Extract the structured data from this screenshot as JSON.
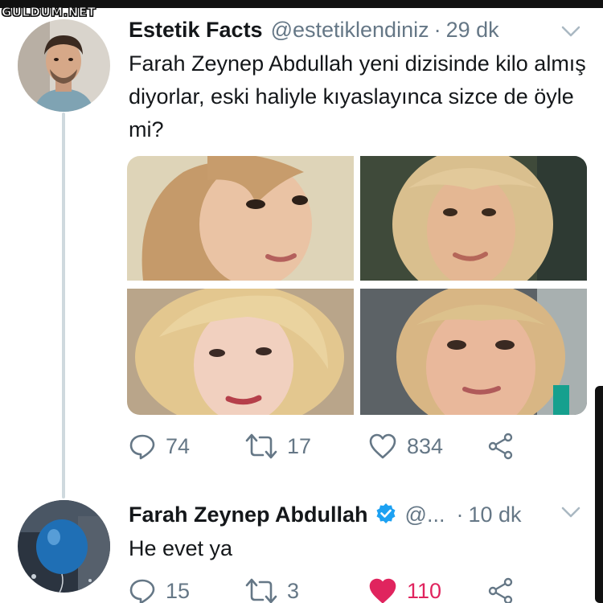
{
  "watermark": "GULDUM.NET",
  "colors": {
    "text": "#14171a",
    "secondary": "#657786",
    "verified": "#1da1f2",
    "like_active": "#e0245e",
    "thread_line": "#cfd9de"
  },
  "tweets": [
    {
      "name": "Estetik Facts",
      "handle": "@estetiklendiniz",
      "separator": "·",
      "time": "29 dk",
      "text": "Farah Zeynep Abdullah yeni dizisinde kilo almış diyorlar, eski haliyle kıyaslayınca sizce de öyle mi?",
      "media_count": 4,
      "reply_count": "74",
      "retweet_count": "17",
      "like_count": "834",
      "icons": [
        "reply-icon",
        "retweet-icon",
        "heart-icon",
        "share-icon",
        "chevron-down-icon"
      ]
    },
    {
      "name": "Farah Zeynep Abdullah",
      "verified": true,
      "handle": "@...",
      "separator": "·",
      "time": "10 dk",
      "text": "He evet ya",
      "reply_count": "15",
      "retweet_count": "3",
      "like_count": "110",
      "liked": true,
      "icons": [
        "reply-icon",
        "retweet-icon",
        "heart-filled-icon",
        "share-icon",
        "chevron-down-icon",
        "verified-badge-icon"
      ]
    }
  ]
}
